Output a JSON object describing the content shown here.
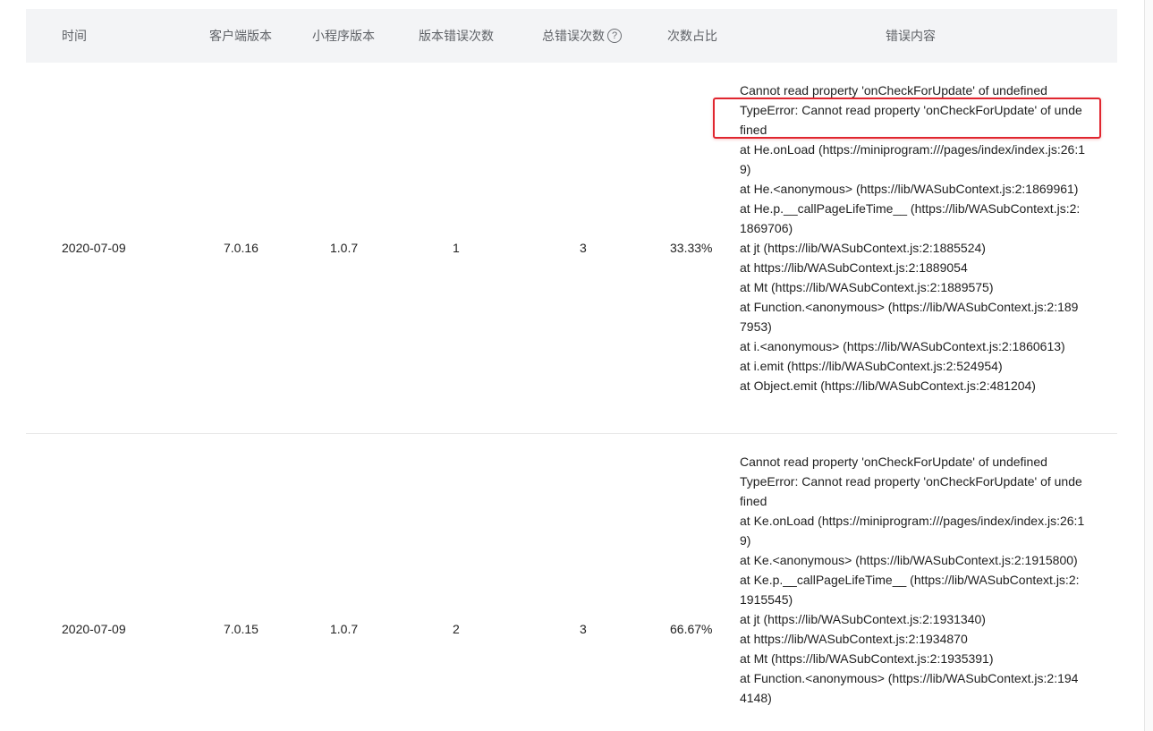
{
  "columns": {
    "time": "时间",
    "client_version": "客户端版本",
    "miniprogram_version": "小程序版本",
    "version_error_count": "版本错误次数",
    "total_error_count": "总错误次数",
    "total_error_help_icon": "?",
    "ratio": "次数占比",
    "error_content": "错误内容"
  },
  "rows": [
    {
      "time": "2020-07-09",
      "client_version": "7.0.16",
      "miniprogram_version": "1.0.7",
      "version_error_count": "1",
      "total_error_count": "3",
      "ratio": "33.33%",
      "error_lines": [
        "Cannot read property 'onCheckForUpdate' of undefined",
        "TypeError: Cannot read property 'onCheckForUpdate' of undefined",
        "at He.onLoad (https://miniprogram:///pages/index/index.js:26:19)",
        "at He.<anonymous> (https://lib/WASubContext.js:2:1869961)",
        "at He.p.__callPageLifeTime__ (https://lib/WASubContext.js:2:1869706)",
        "at jt (https://lib/WASubContext.js:2:1885524)",
        "at https://lib/WASubContext.js:2:1889054",
        "at Mt (https://lib/WASubContext.js:2:1889575)",
        "at Function.<anonymous> (https://lib/WASubContext.js:2:1897953)",
        "at i.<anonymous> (https://lib/WASubContext.js:2:1860613)",
        "at i.emit (https://lib/WASubContext.js:2:524954)",
        "at Object.emit (https://lib/WASubContext.js:2:481204)"
      ]
    },
    {
      "time": "2020-07-09",
      "client_version": "7.0.15",
      "miniprogram_version": "1.0.7",
      "version_error_count": "2",
      "total_error_count": "3",
      "ratio": "66.67%",
      "error_lines": [
        "Cannot read property 'onCheckForUpdate' of undefined",
        "TypeError: Cannot read property 'onCheckForUpdate' of undefined",
        "at Ke.onLoad (https://miniprogram:///pages/index/index.js:26:19)",
        "at Ke.<anonymous> (https://lib/WASubContext.js:2:1915800)",
        "at Ke.p.__callPageLifeTime__ (https://lib/WASubContext.js:2:1915545)",
        "at jt (https://lib/WASubContext.js:2:1931340)",
        "at https://lib/WASubContext.js:2:1934870",
        "at Mt (https://lib/WASubContext.js:2:1935391)",
        "at Function.<anonymous> (https://lib/WASubContext.js:2:1944148)"
      ]
    }
  ],
  "highlight_color": "#e0262f"
}
